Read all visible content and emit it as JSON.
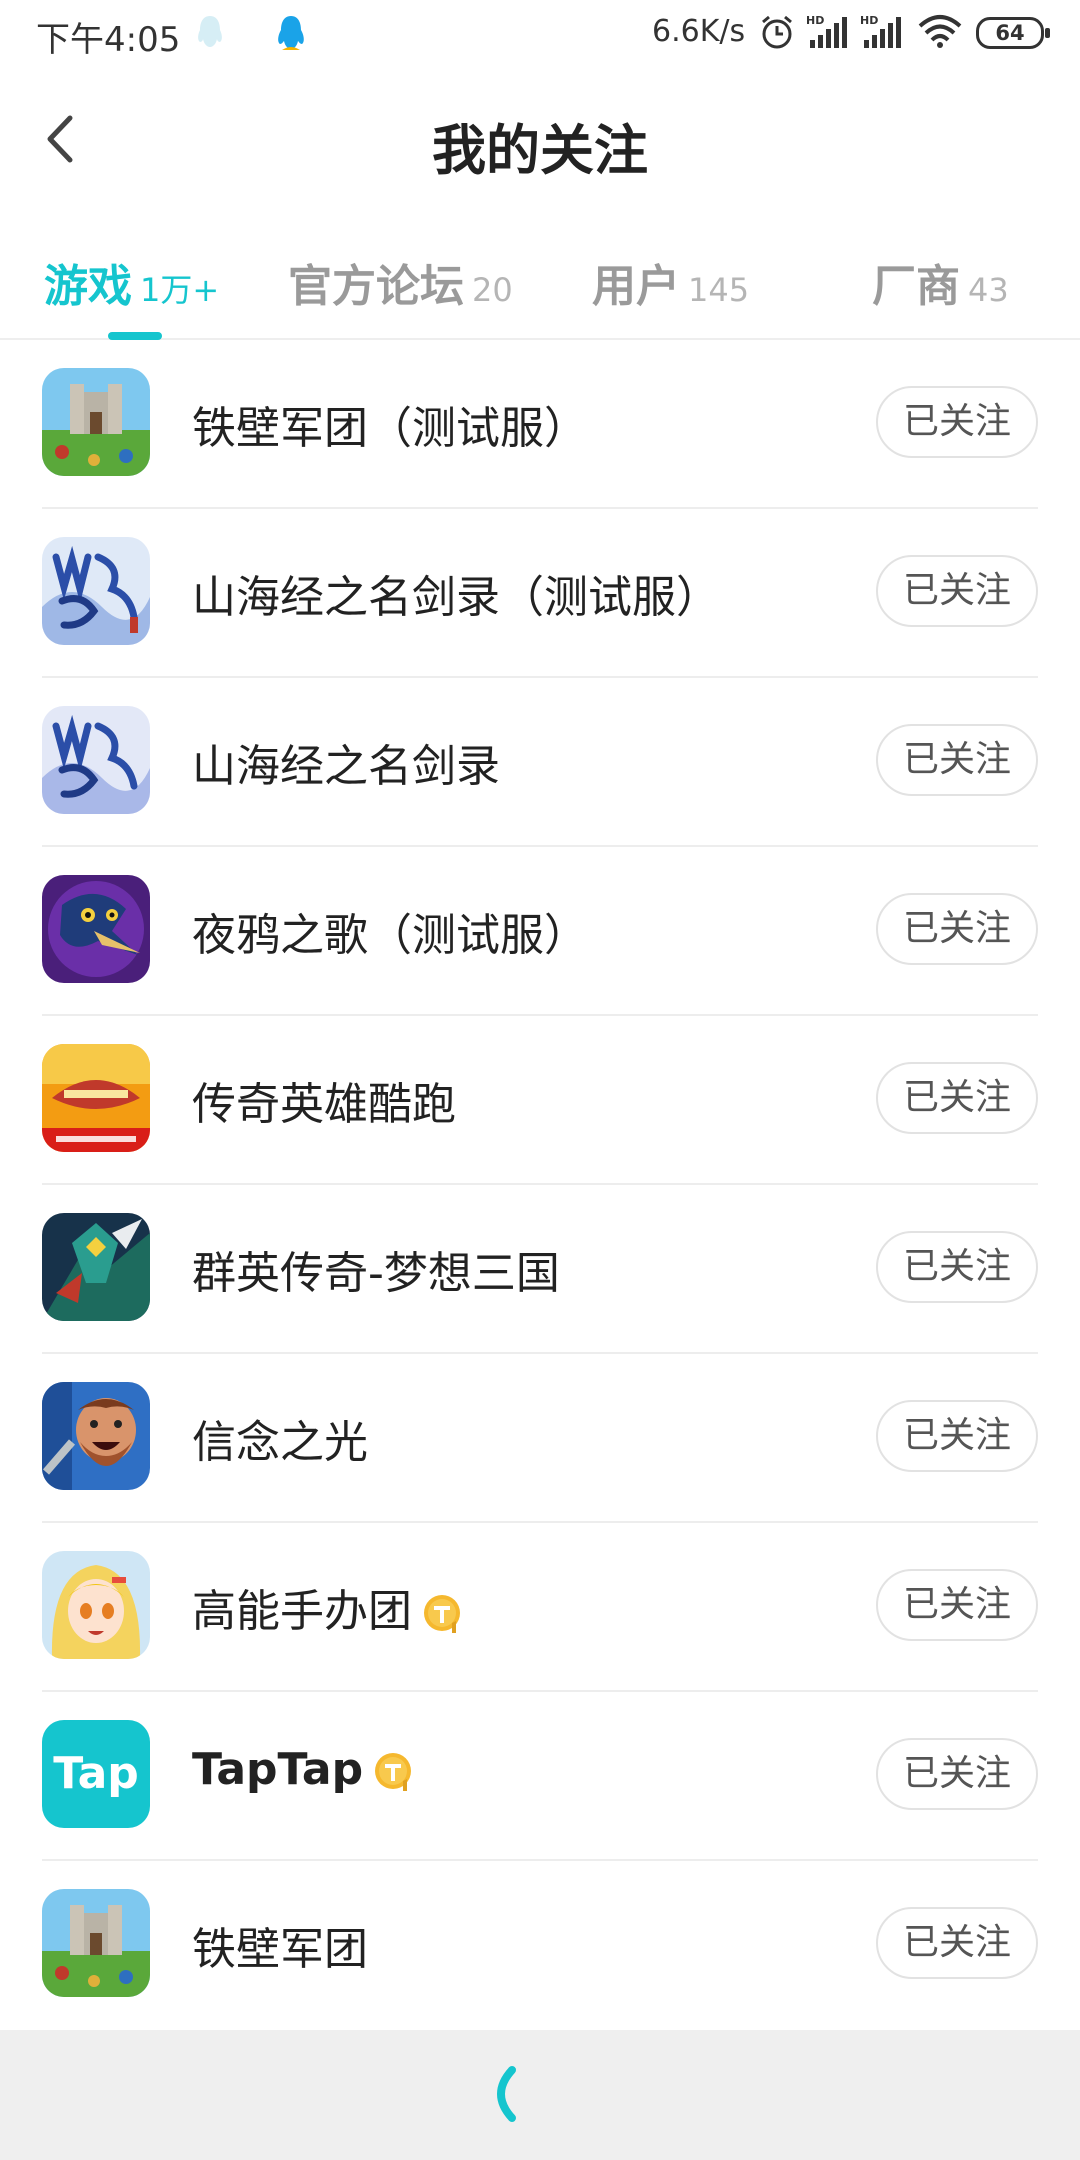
{
  "status_bar": {
    "time": "下午4:05",
    "speed": "6.6K/s",
    "battery": "64",
    "icons": [
      "qq-ghost-icon",
      "qq-penguin-icon",
      "alarm-icon",
      "hd-signal-icon",
      "hd-signal-icon",
      "wifi-icon",
      "battery-icon"
    ]
  },
  "header": {
    "title": "我的关注",
    "back_icon": "chevron-left-icon"
  },
  "tabs": [
    {
      "label": "游戏",
      "count": "1万+",
      "active": true
    },
    {
      "label": "官方论坛",
      "count": "20",
      "active": false
    },
    {
      "label": "用户",
      "count": "145",
      "active": false
    },
    {
      "label": "厂商",
      "count": "43",
      "active": false
    }
  ],
  "accent_color": "#15c5ce",
  "games": [
    {
      "name": "铁壁军团（测试服）",
      "button": "已关注",
      "icon": "castle-game-icon"
    },
    {
      "name": "山海经之名剑录（测试服）",
      "button": "已关注",
      "icon": "shanhaijing-icon"
    },
    {
      "name": "山海经之名剑录",
      "button": "已关注",
      "icon": "shanhaijing-icon"
    },
    {
      "name": "夜鸦之歌（测试服）",
      "button": "已关注",
      "icon": "raven-icon"
    },
    {
      "name": "传奇英雄酷跑",
      "button": "已关注",
      "icon": "legend-run-icon"
    },
    {
      "name": "群英传奇-梦想三国",
      "button": "已关注",
      "icon": "warrior-icon"
    },
    {
      "name": "信念之光",
      "button": "已关注",
      "icon": "dwarf-icon"
    },
    {
      "name": "高能手办团",
      "button": "已关注",
      "icon": "anime-girl-icon",
      "badge": true
    },
    {
      "name": "TapTap",
      "button": "已关注",
      "icon": "taptap-icon",
      "badge": true,
      "icon_text": "Tap"
    },
    {
      "name": "铁壁军团",
      "button": "已关注",
      "icon": "castle-game-icon"
    }
  ]
}
